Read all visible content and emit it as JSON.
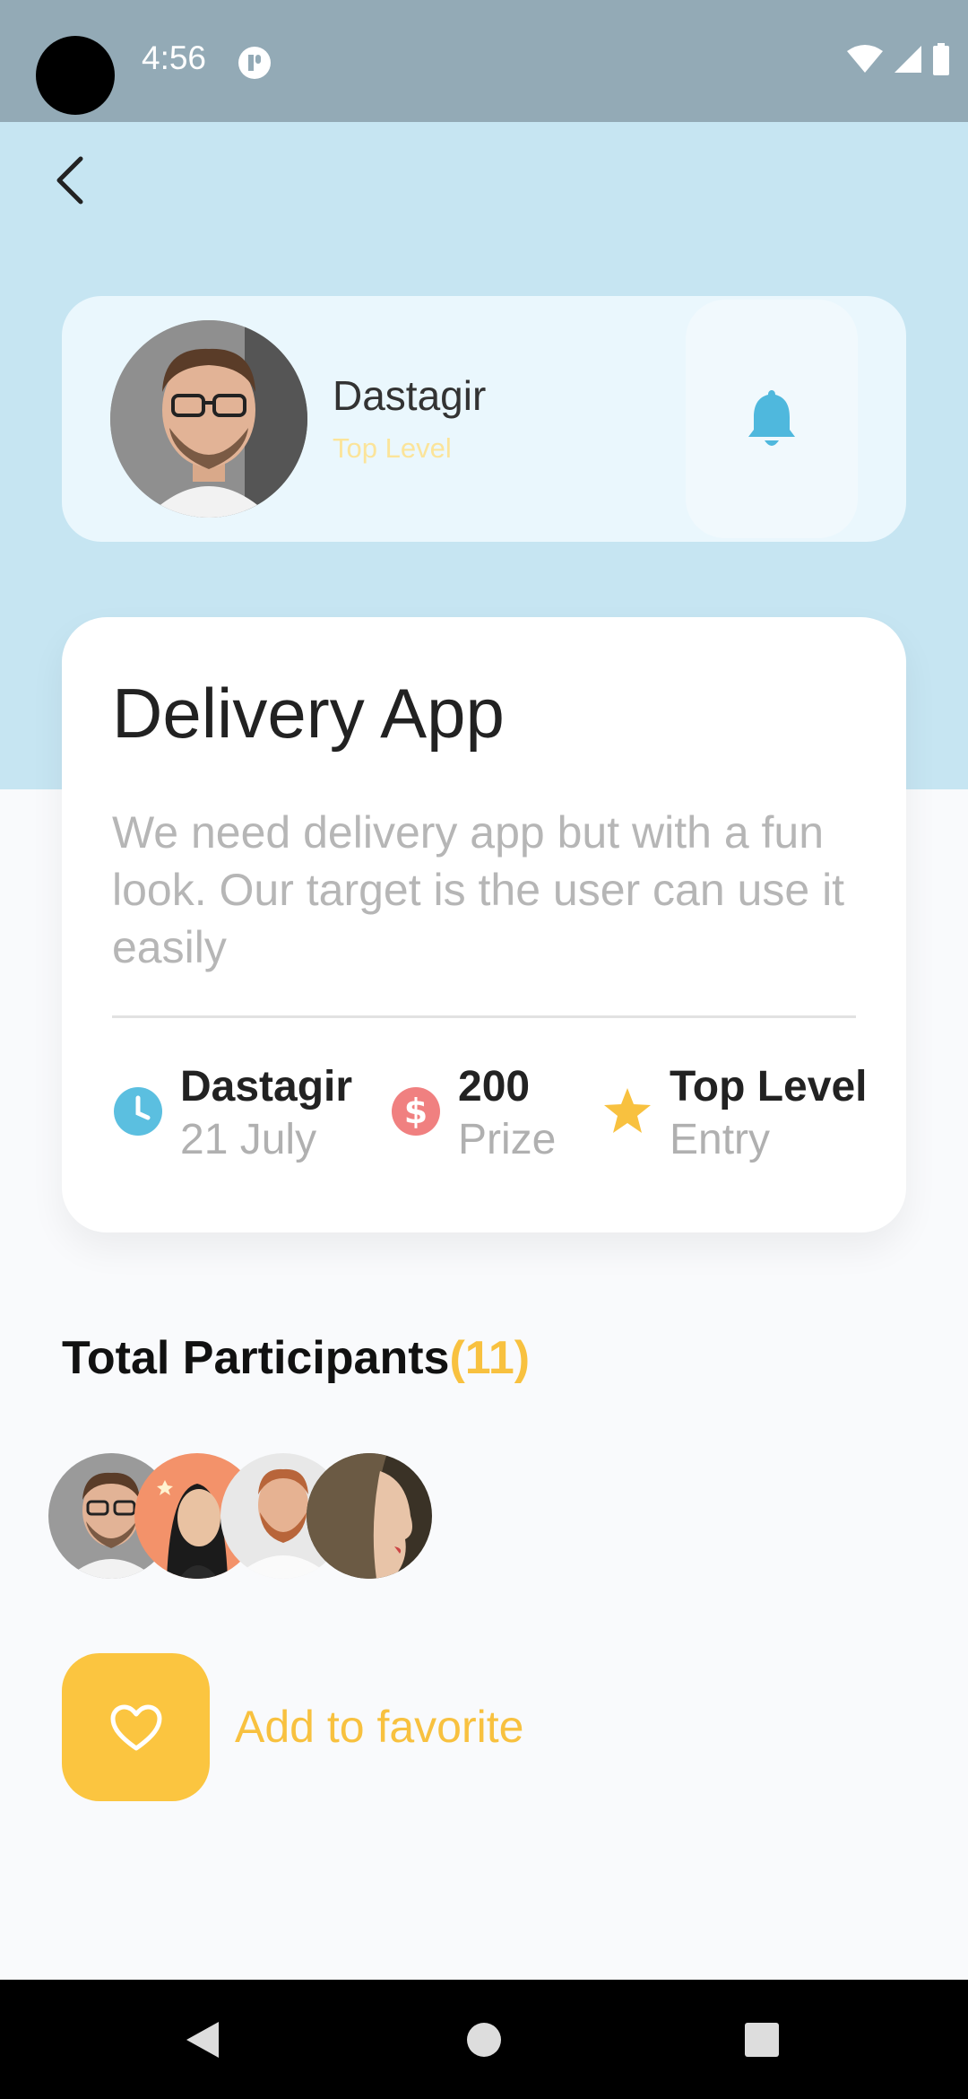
{
  "status_bar": {
    "time": "4:56",
    "icons": [
      "app-notification-icon",
      "wifi-icon",
      "cell-signal-icon",
      "battery-icon"
    ]
  },
  "header": {
    "back_icon": "back-arrow-icon"
  },
  "profile": {
    "name": "Dastagir",
    "level": "Top Level",
    "bell_icon": "bell-icon"
  },
  "task": {
    "title": "Delivery App",
    "description": "We need delivery app but with a fun look. Our target is the user can use it easily",
    "stats": [
      {
        "value": "Dastagir",
        "label": "21 July",
        "icon": "clock-icon",
        "color": "#5bbfe0"
      },
      {
        "value": "200",
        "label": "Prize",
        "icon": "dollar-icon",
        "color": "#f08080"
      },
      {
        "value": "Top Level",
        "label": "Entry",
        "icon": "star-icon",
        "color": "#f8c13f"
      }
    ]
  },
  "participants": {
    "title": "Total Participants",
    "count": "(11)"
  },
  "favorite": {
    "label": "Add to favorite",
    "icon": "heart-icon"
  },
  "colors": {
    "accent": "#f8c13f",
    "hero": "#c6e5f2",
    "bell": "#4fb8dd"
  }
}
